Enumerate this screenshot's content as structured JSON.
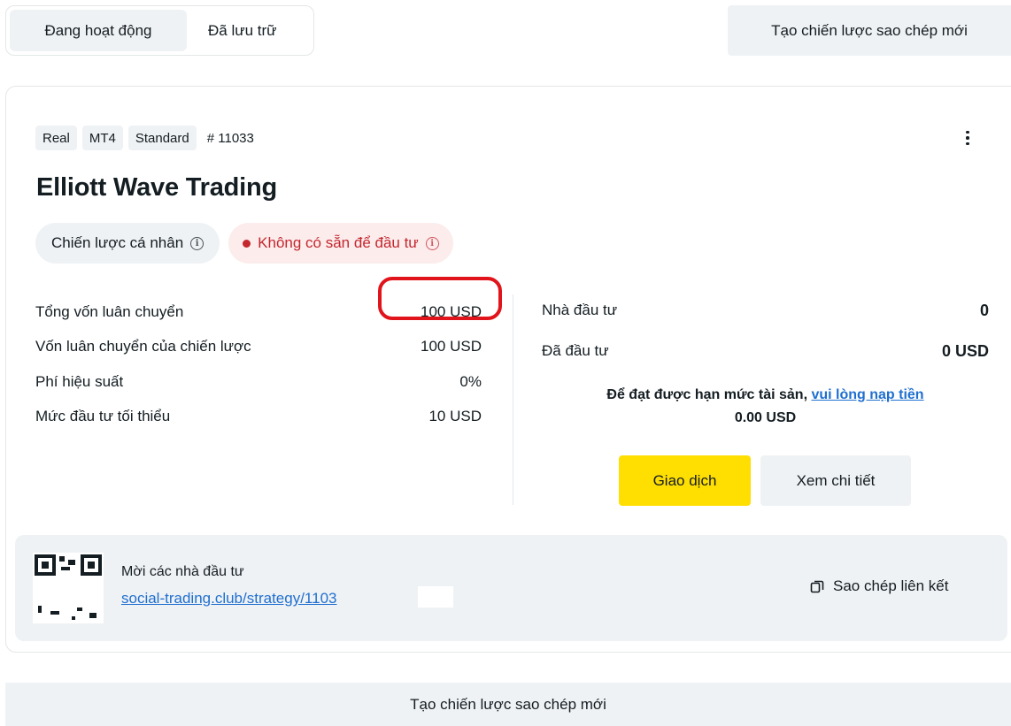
{
  "tabs": [
    {
      "label": "Đang hoạt động",
      "active": true
    },
    {
      "label": "Đã lưu trữ",
      "active": false
    }
  ],
  "top_create_label": "Tạo chiến lược sao chép mới",
  "card": {
    "tags": [
      "Real",
      "MT4",
      "Standard"
    ],
    "account_id": "# 11033",
    "title": "Elliott Wave Trading",
    "pill_personal": "Chiến lược cá nhân",
    "pill_unavailable": "Không có sẵn để đầu tư",
    "stats": [
      {
        "label": "Tổng vốn luân chuyển",
        "value": "100 USD"
      },
      {
        "label": "Vốn luân chuyển của chiến lược",
        "value": "100 USD"
      },
      {
        "label": "Phí hiệu suất",
        "value": "0%"
      },
      {
        "label": "Mức đầu tư tối thiểu",
        "value": "10 USD"
      }
    ],
    "investors_label": "Nhà đầu tư",
    "investors_value": "0",
    "invested_label": "Đã đầu tư",
    "invested_value": "0 USD",
    "deposit_prefix": "Để đạt được hạn mức tài sản,",
    "deposit_link": "vui lòng nạp tiền",
    "deposit_amount": "0.00 USD",
    "trade_button": "Giao dịch",
    "detail_button": "Xem chi tiết"
  },
  "invite": {
    "label": "Mời các nhà đầu tư",
    "link": "social-trading.club/strategy/1103",
    "copy_label": "Sao chép liên kết"
  },
  "bottom_create_label": "Tạo chiến lược sao chép mới",
  "colors": {
    "accent_yellow": "#ffde02",
    "link_blue": "#1f6fd0",
    "error_red": "#c4272e",
    "surface_grey": "#eff2f4",
    "annotation_red": "#e0141a"
  }
}
